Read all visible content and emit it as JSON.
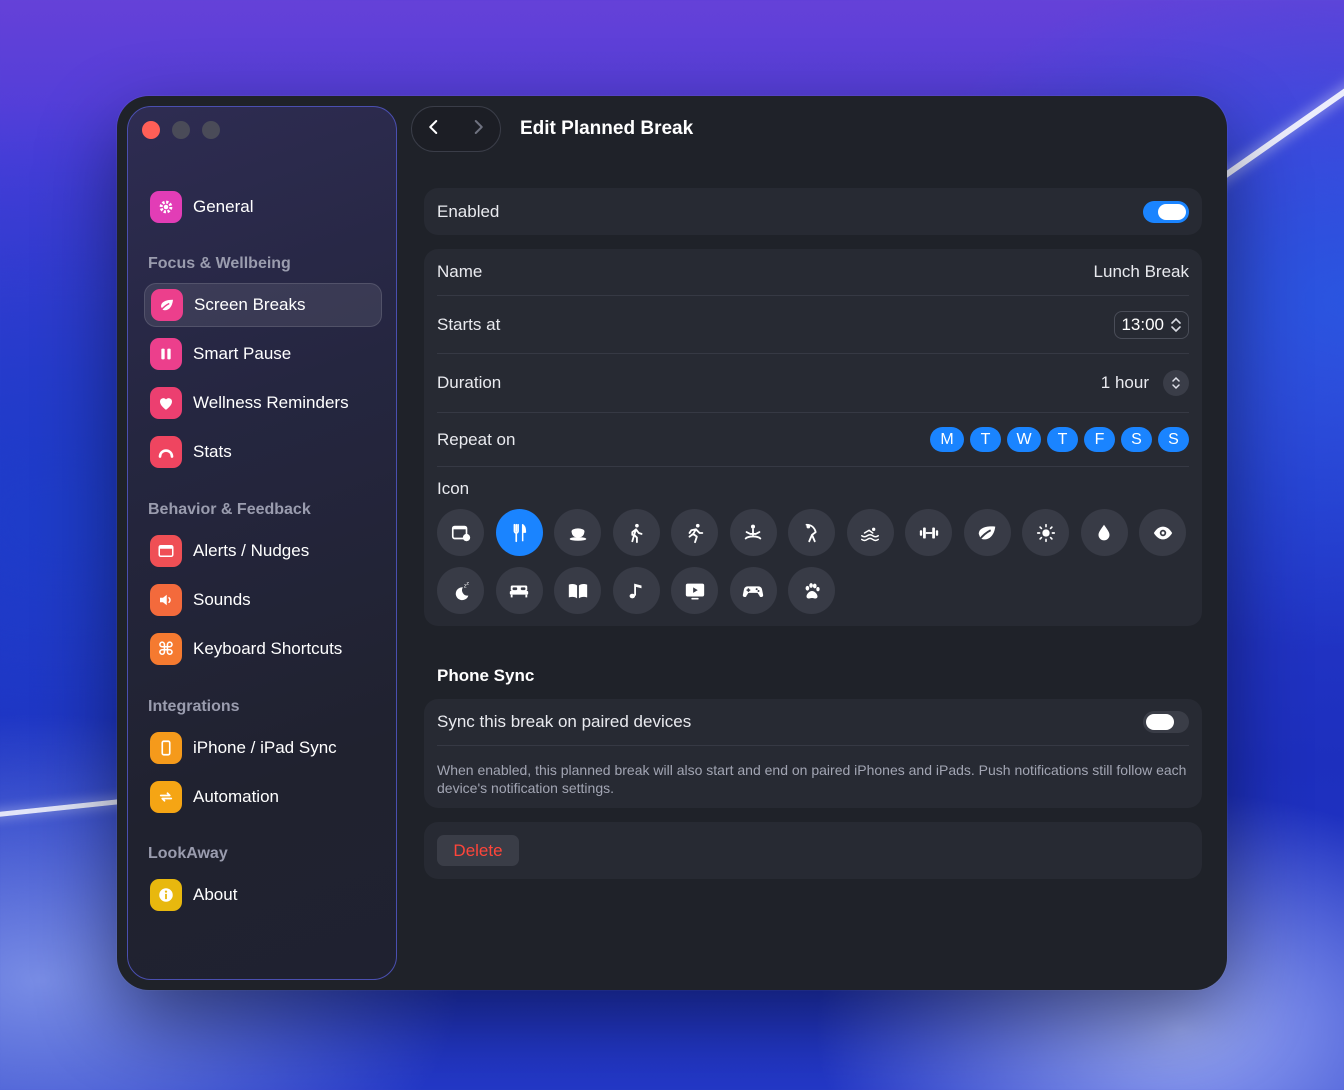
{
  "window": {
    "title": "Edit Planned Break",
    "nav": {
      "back_icon": "chevron-left-icon",
      "forward_icon": "chevron-right-icon"
    }
  },
  "sidebar": {
    "top_item": {
      "label": "General",
      "icon": "gear-icon",
      "color": "#e23db6"
    },
    "sections": [
      {
        "title": "Focus & Wellbeing",
        "items": [
          {
            "label": "Screen Breaks",
            "icon": "leaf-icon",
            "color": "#ec3f8c",
            "active": true
          },
          {
            "label": "Smart Pause",
            "icon": "pause-icon",
            "color": "#ec3f8c"
          },
          {
            "label": "Wellness Reminders",
            "icon": "heart-icon",
            "color": "#ec3f70"
          },
          {
            "label": "Stats",
            "icon": "gauge-icon",
            "color": "#ef4560"
          }
        ]
      },
      {
        "title": "Behavior & Feedback",
        "items": [
          {
            "label": "Alerts / Nudges",
            "icon": "alert-window-icon",
            "color": "#ef4f55"
          },
          {
            "label": "Sounds",
            "icon": "speaker-icon",
            "color": "#f36a3c"
          },
          {
            "label": "Keyboard Shortcuts",
            "icon": "command-icon",
            "color": "#f57a30"
          }
        ]
      },
      {
        "title": "Integrations",
        "items": [
          {
            "label": "iPhone / iPad Sync",
            "icon": "phone-icon",
            "color": "#f59a1b"
          },
          {
            "label": "Automation",
            "icon": "repeat-icon",
            "color": "#f5a514"
          }
        ]
      },
      {
        "title": "LookAway",
        "items": [
          {
            "label": "About",
            "icon": "info-icon",
            "color": "#e8b80e"
          }
        ]
      }
    ]
  },
  "form": {
    "enabled": {
      "label": "Enabled",
      "value": true
    },
    "name": {
      "label": "Name",
      "value": "Lunch Break"
    },
    "starts_at": {
      "label": "Starts at",
      "value": "13:00"
    },
    "duration": {
      "label": "Duration",
      "value": "1 hour"
    },
    "repeat_on": {
      "label": "Repeat on",
      "days": [
        "M",
        "T",
        "W",
        "T",
        "F",
        "S",
        "S"
      ]
    },
    "icon": {
      "label": "Icon",
      "selected_index": 1,
      "options": [
        "calendar-clock-icon",
        "fork-knife-icon",
        "cup-icon",
        "walk-icon",
        "run-icon",
        "meditate-icon",
        "stretch-icon",
        "swim-icon",
        "dumbbell-icon",
        "leaf-icon",
        "sun-icon",
        "drop-icon",
        "eye-icon",
        "moon-zzz-icon",
        "bed-icon",
        "book-icon",
        "music-note-icon",
        "play-screen-icon",
        "gamepad-icon",
        "paw-icon"
      ]
    }
  },
  "phone_sync": {
    "title": "Phone Sync",
    "toggle_label": "Sync this break on paired devices",
    "value": false,
    "note": "When enabled, this planned break will also start and end on paired iPhones and iPads. Push notifications still follow each device's notification settings."
  },
  "delete": {
    "label": "Delete"
  },
  "colors": {
    "accent": "#1a84ff",
    "danger": "#ff453a",
    "window_bg": "#1f2229",
    "card_bg": "#272a33"
  }
}
